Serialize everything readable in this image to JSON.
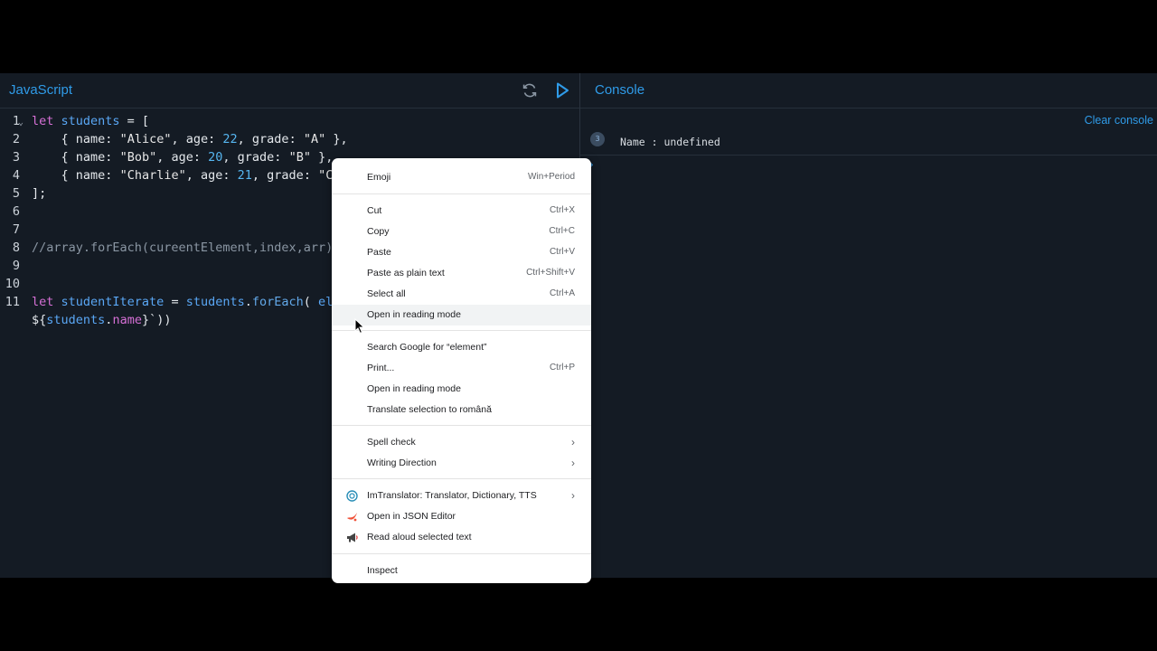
{
  "editor": {
    "title": "JavaScript",
    "lines": [
      {
        "n": "1",
        "tokens": [
          {
            "c": "kw",
            "t": "let "
          },
          {
            "c": "var",
            "t": "students"
          },
          {
            "c": "punc",
            "t": " = ["
          }
        ]
      },
      {
        "n": "2",
        "tokens": [
          {
            "c": "punc",
            "t": "    { "
          },
          {
            "c": "prop",
            "t": "name"
          },
          {
            "c": "punc",
            "t": ": "
          },
          {
            "c": "str",
            "t": "\"Alice\""
          },
          {
            "c": "punc",
            "t": ", "
          },
          {
            "c": "prop",
            "t": "age"
          },
          {
            "c": "punc",
            "t": ": "
          },
          {
            "c": "num",
            "t": "22"
          },
          {
            "c": "punc",
            "t": ", "
          },
          {
            "c": "prop",
            "t": "grade"
          },
          {
            "c": "punc",
            "t": ": "
          },
          {
            "c": "str",
            "t": "\"A\""
          },
          {
            "c": "punc",
            "t": " },"
          }
        ]
      },
      {
        "n": "3",
        "tokens": [
          {
            "c": "punc",
            "t": "    { "
          },
          {
            "c": "prop",
            "t": "name"
          },
          {
            "c": "punc",
            "t": ": "
          },
          {
            "c": "str",
            "t": "\"Bob\""
          },
          {
            "c": "punc",
            "t": ", "
          },
          {
            "c": "prop",
            "t": "age"
          },
          {
            "c": "punc",
            "t": ": "
          },
          {
            "c": "num",
            "t": "20"
          },
          {
            "c": "punc",
            "t": ", "
          },
          {
            "c": "prop",
            "t": "grade"
          },
          {
            "c": "punc",
            "t": ": "
          },
          {
            "c": "str",
            "t": "\"B\""
          },
          {
            "c": "punc",
            "t": " },"
          }
        ]
      },
      {
        "n": "4",
        "tokens": [
          {
            "c": "punc",
            "t": "    { "
          },
          {
            "c": "prop",
            "t": "name"
          },
          {
            "c": "punc",
            "t": ": "
          },
          {
            "c": "str",
            "t": "\"Charlie\""
          },
          {
            "c": "punc",
            "t": ", "
          },
          {
            "c": "prop",
            "t": "age"
          },
          {
            "c": "punc",
            "t": ": "
          },
          {
            "c": "num",
            "t": "21"
          },
          {
            "c": "punc",
            "t": ", "
          },
          {
            "c": "prop",
            "t": "grade"
          },
          {
            "c": "punc",
            "t": ": "
          },
          {
            "c": "str",
            "t": "\"C\""
          }
        ]
      },
      {
        "n": "5",
        "tokens": [
          {
            "c": "punc",
            "t": "];"
          }
        ]
      },
      {
        "n": "6",
        "tokens": []
      },
      {
        "n": "7",
        "tokens": []
      },
      {
        "n": "8",
        "tokens": [
          {
            "c": "cmt",
            "t": "//array.forEach(cureentElement,index,arr)"
          }
        ]
      },
      {
        "n": "9",
        "tokens": []
      },
      {
        "n": "10",
        "tokens": []
      },
      {
        "n": "11",
        "tokens": [
          {
            "c": "kw",
            "t": "let "
          },
          {
            "c": "var",
            "t": "studentIterate"
          },
          {
            "c": "punc",
            "t": " = "
          },
          {
            "c": "var",
            "t": "students"
          },
          {
            "c": "punc",
            "t": "."
          },
          {
            "c": "fn",
            "t": "forEach"
          },
          {
            "c": "punc",
            "t": "( "
          },
          {
            "c": "var",
            "t": "ele"
          }
        ]
      },
      {
        "n": "",
        "tokens": [
          {
            "c": "punc",
            "t": "${"
          },
          {
            "c": "var",
            "t": "students"
          },
          {
            "c": "punc",
            "t": "."
          },
          {
            "c": "kw",
            "t": "name"
          },
          {
            "c": "punc",
            "t": "}`))"
          }
        ]
      }
    ]
  },
  "console": {
    "title": "Console",
    "clear_label": "Clear console",
    "log_count": "3",
    "log_text": "Name : undefined",
    "prompt": "›"
  },
  "context_menu": {
    "items": [
      {
        "label": "Emoji",
        "shortcut": "Win+Period"
      },
      {
        "label": "Cut",
        "shortcut": "Ctrl+X"
      },
      {
        "label": "Copy",
        "shortcut": "Ctrl+C"
      },
      {
        "label": "Paste",
        "shortcut": "Ctrl+V"
      },
      {
        "label": "Paste as plain text",
        "shortcut": "Ctrl+Shift+V"
      },
      {
        "label": "Select all",
        "shortcut": "Ctrl+A"
      },
      {
        "label": "Open in reading mode",
        "shortcut": ""
      },
      {
        "label": "Search Google for “element”",
        "shortcut": ""
      },
      {
        "label": "Print...",
        "shortcut": "Ctrl+P"
      },
      {
        "label": "Open in reading mode",
        "shortcut": ""
      },
      {
        "label": "Translate selection to română",
        "shortcut": ""
      },
      {
        "label": "Spell check",
        "shortcut": ""
      },
      {
        "label": "Writing Direction",
        "shortcut": ""
      },
      {
        "label": "ImTranslator: Translator, Dictionary, TTS",
        "shortcut": ""
      },
      {
        "label": "Open in JSON Editor",
        "shortcut": ""
      },
      {
        "label": "Read aloud selected text",
        "shortcut": ""
      },
      {
        "label": "Inspect",
        "shortcut": ""
      }
    ]
  },
  "colors": {
    "accent": "#2f9be8",
    "background": "#141b24",
    "keyword": "#d670d6",
    "variable": "#5aa7f5"
  }
}
